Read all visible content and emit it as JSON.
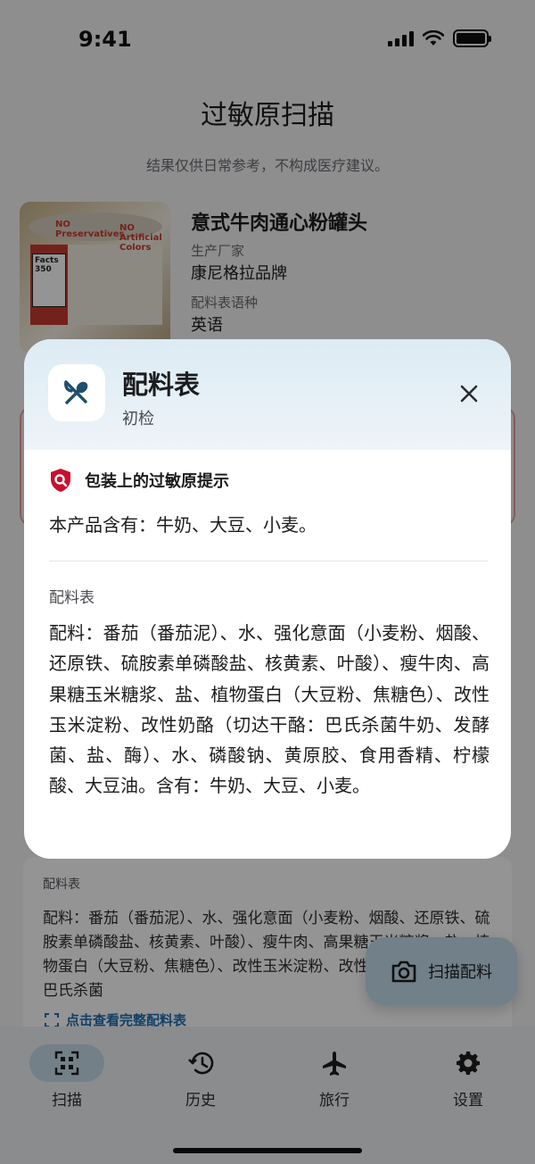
{
  "status_bar": {
    "time": "9:41"
  },
  "header": {
    "title": "过敏原扫描",
    "disclaimer": "结果仅供日常参考，不构成医疗建议。"
  },
  "product": {
    "name": "意式牛肉通心粉罐头",
    "manufacturer_label": "生产厂家",
    "manufacturer": "康尼格拉品牌",
    "language_label": "配料表语种",
    "language": "英语",
    "image_text": {
      "top_left": "NO Preservatives",
      "top_right": "NO Artificial Colors",
      "facts": "Facts",
      "numbers": "350"
    }
  },
  "background_card": {
    "heading": "配料表",
    "text": "配料：番茄（番茄泥）、水、强化意面（小麦粉、烟酸、还原铁、硫胺素单磷酸盐、核黄素、叶酸）、瘦牛肉、高果糖玉米糖浆、盐、植物蛋白（大豆粉、焦糖色）、改性玉米淀粉、改性奶酪（切达干酪：巴氏杀菌",
    "link": "点击查看完整配料表"
  },
  "fab": {
    "label": "扫描配料",
    "icon": "camera-icon"
  },
  "tabs": [
    {
      "label": "扫描",
      "icon": "scan-icon",
      "active": true
    },
    {
      "label": "历史",
      "icon": "history-icon",
      "active": false
    },
    {
      "label": "旅行",
      "icon": "airplane-icon",
      "active": false
    },
    {
      "label": "设置",
      "icon": "gear-icon",
      "active": false
    }
  ],
  "sheet": {
    "title": "配料表",
    "subtitle": "初检",
    "icon": "utensils-icon",
    "allergen_title": "包装上的过敏原提示",
    "allergen_text": "本产品含有：牛奶、大豆、小麦。",
    "ingredients_heading": "配料表",
    "ingredients_text": "配料：番茄（番茄泥）、水、强化意面（小麦粉、烟酸、还原铁、硫胺素单磷酸盐、核黄素、叶酸）、瘦牛肉、高果糖玉米糖浆、盐、植物蛋白（大豆粉、焦糖色）、改性玉米淀粉、改性奶酪（切达干酪：巴氏杀菌牛奶、发酵菌、盐、酶）、水、磷酸钠、黄原胶、食用香精、柠檬酸、大豆油。含有：牛奶、大豆、小麦。"
  },
  "colors": {
    "accent": "#1e6fb3",
    "fab_bg": "#c3dcec",
    "alert_red": "#c8102e",
    "sheet_header": "#dcebf4"
  }
}
